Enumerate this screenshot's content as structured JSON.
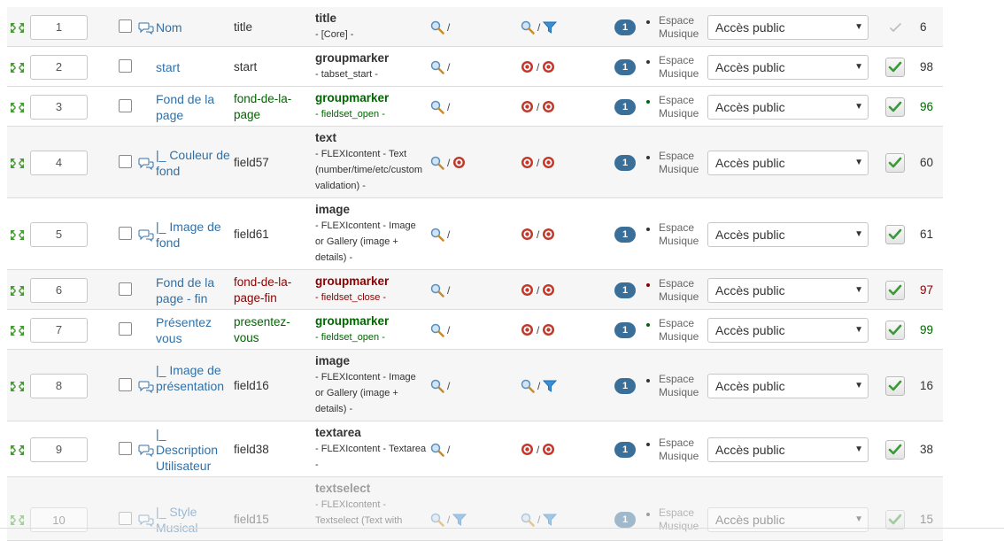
{
  "fields": [
    {
      "order": "1",
      "label": "Nom",
      "name": "title",
      "name_color": "default",
      "type": "title",
      "type_color": "default",
      "type_desc": "- [Core] -",
      "icons1": [
        "search",
        "slash"
      ],
      "icons2": [
        "search",
        "slash",
        "filter"
      ],
      "badge": "1",
      "access_line1": "Espace",
      "access_line2": "Musique",
      "access_value": "Accès public",
      "published": "plain",
      "id": "6",
      "id_color": "default",
      "comment": true
    },
    {
      "order": "2",
      "label": "start",
      "name": "start",
      "name_color": "default",
      "type": "groupmarker",
      "type_color": "default",
      "type_desc": "- tabset_start -",
      "icons1": [
        "search",
        "slash"
      ],
      "icons2": [
        "stop",
        "slash",
        "stop"
      ],
      "badge": "1",
      "access_line1": "Espace",
      "access_line2": "Musique",
      "access_value": "Accès public",
      "published": "check",
      "id": "98",
      "id_color": "default",
      "comment": false
    },
    {
      "order": "3",
      "label": "Fond de la page",
      "name": "fond-de-la-page",
      "name_color": "green",
      "type": "groupmarker",
      "type_color": "green",
      "type_desc": "- fieldset_open -",
      "icons1": [
        "search",
        "slash"
      ],
      "icons2": [
        "stop",
        "slash",
        "stop"
      ],
      "badge": "1",
      "access_line1": "Espace",
      "access_line2": "Musique",
      "access_value": "Accès public",
      "published": "check",
      "id": "96",
      "id_color": "green",
      "comment": false
    },
    {
      "order": "4",
      "label": "|_ Couleur de fond",
      "name": "field57",
      "name_color": "default",
      "type": "text",
      "type_color": "default",
      "type_desc": "- FLEXIcontent - Text (number/time/etc/custom validation) -",
      "icons1": [
        "search",
        "slash",
        "stop"
      ],
      "icons2": [
        "stop",
        "slash",
        "stop"
      ],
      "badge": "1",
      "access_line1": "Espace",
      "access_line2": "Musique",
      "access_value": "Accès public",
      "published": "check",
      "id": "60",
      "id_color": "default",
      "comment": true
    },
    {
      "order": "5",
      "label": "|_ Image de fond",
      "name": "field61",
      "name_color": "default",
      "type": "image",
      "type_color": "default",
      "type_desc": "- FLEXIcontent - Image or Gallery (image + details) -",
      "icons1": [
        "search",
        "slash"
      ],
      "icons2": [
        "stop",
        "slash",
        "stop"
      ],
      "badge": "1",
      "access_line1": "Espace",
      "access_line2": "Musique",
      "access_value": "Accès public",
      "published": "check",
      "id": "61",
      "id_color": "default",
      "comment": true
    },
    {
      "order": "6",
      "label": "Fond de la page - fin",
      "name": "fond-de-la-page-fin",
      "name_color": "red",
      "type": "groupmarker",
      "type_color": "red",
      "type_desc": "- fieldset_close -",
      "icons1": [
        "search",
        "slash"
      ],
      "icons2": [
        "stop",
        "slash",
        "stop"
      ],
      "badge": "1",
      "access_line1": "Espace",
      "access_line2": "Musique",
      "access_value": "Accès public",
      "published": "check",
      "id": "97",
      "id_color": "red",
      "comment": false
    },
    {
      "order": "7",
      "label": "Présentez vous",
      "name": "presentez-vous",
      "name_color": "green",
      "type": "groupmarker",
      "type_color": "green",
      "type_desc": "- fieldset_open -",
      "icons1": [
        "search",
        "slash"
      ],
      "icons2": [
        "stop",
        "slash",
        "stop"
      ],
      "badge": "1",
      "access_line1": "Espace",
      "access_line2": "Musique",
      "access_value": "Accès public",
      "published": "check",
      "id": "99",
      "id_color": "green",
      "comment": false
    },
    {
      "order": "8",
      "label": "|_ Image de présentation",
      "name": "field16",
      "name_color": "default",
      "type": "image",
      "type_color": "default",
      "type_desc": "- FLEXIcontent - Image or Gallery (image + details) -",
      "icons1": [
        "search",
        "slash"
      ],
      "icons2": [
        "search",
        "slash",
        "filter"
      ],
      "badge": "1",
      "access_line1": "Espace",
      "access_line2": "Musique",
      "access_value": "Accès public",
      "published": "check",
      "id": "16",
      "id_color": "default",
      "comment": true
    },
    {
      "order": "9",
      "label": "|_ Description Utilisateur",
      "name": "field38",
      "name_color": "default",
      "type": "textarea",
      "type_color": "default",
      "type_desc": "- FLEXIcontent - Textarea -",
      "icons1": [
        "search",
        "slash"
      ],
      "icons2": [
        "stop",
        "slash",
        "stop"
      ],
      "badge": "1",
      "access_line1": "Espace",
      "access_line2": "Musique",
      "access_value": "Accès public",
      "published": "check",
      "id": "38",
      "id_color": "default",
      "comment": true
    },
    {
      "order": "10",
      "label": "|_ Style Musical",
      "name": "field15",
      "name_color": "default",
      "type": "textselect",
      "type_color": "default",
      "type_desc": "- FLEXIcontent - Textselect (Text with",
      "icons1": [
        "search",
        "slash",
        "filter"
      ],
      "icons2": [
        "search",
        "slash",
        "filter"
      ],
      "badge": "1",
      "access_line1": "Espace",
      "access_line2": "Musique",
      "access_value": "Accès public",
      "published": "check",
      "id": "15",
      "id_color": "default",
      "comment": true
    }
  ],
  "colors": {
    "link": "#3071a9",
    "green": "#006600",
    "red": "#8b0000",
    "badge": "#3a6f9a",
    "stop": "#c0392b",
    "filter": "#3b8fd6"
  }
}
